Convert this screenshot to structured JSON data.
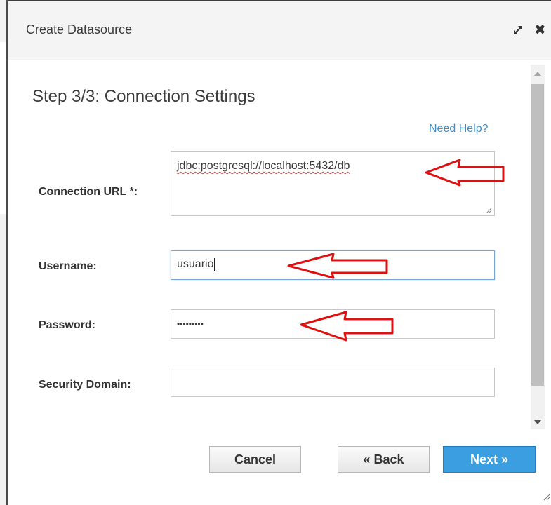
{
  "dialog": {
    "title": "Create Datasource"
  },
  "step": {
    "title": "Step 3/3: Connection Settings",
    "help_link": "Need Help?"
  },
  "form": {
    "connection_url": {
      "label": "Connection URL *:",
      "value": "jdbc:postgresql://localhost:5432/db"
    },
    "username": {
      "label": "Username:",
      "value": "usuario"
    },
    "password": {
      "label": "Password:",
      "value": "•••••••••"
    },
    "security_domain": {
      "label": "Security Domain:",
      "value": ""
    }
  },
  "buttons": {
    "cancel": "Cancel",
    "back": "« Back",
    "next": "Next »"
  },
  "icons": {
    "maximize": "maximize-icon",
    "close": "close-icon",
    "annotation_arrow": "left-arrow-annotation"
  },
  "colors": {
    "primary_button": "#3a9ee0",
    "link": "#3a8fd1",
    "annotation": "#e01010",
    "spellcheck": "#e04040"
  }
}
